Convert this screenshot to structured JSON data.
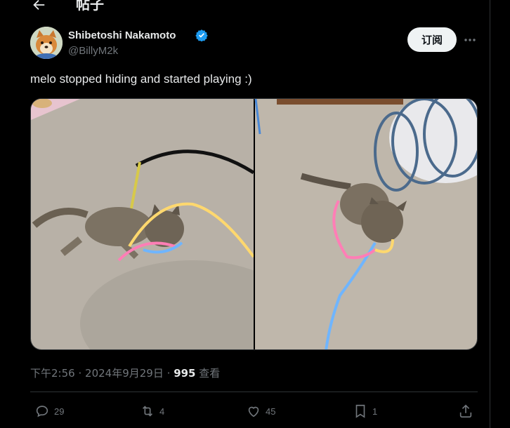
{
  "header": {
    "title": "帖子",
    "back_icon": "back-arrow-icon"
  },
  "author": {
    "display_name": "Shibetoshi Nakamoto",
    "handle": "@BillyM2k",
    "verified_icon": "verified-badge-icon",
    "verified_color": "#1d9bf0"
  },
  "subscribe_label": "订阅",
  "more_icon": "more-horizontal-icon",
  "tweet": {
    "text": "melo stopped hiding and started playing :)"
  },
  "meta": {
    "time": "下午2:56",
    "sep1": "·",
    "date": "2024年9月29日",
    "sep2": "·",
    "views_count": "995",
    "views_label": "查看"
  },
  "actions": {
    "reply": {
      "icon": "reply-icon",
      "count": "29"
    },
    "repost": {
      "icon": "repost-icon",
      "count": "4"
    },
    "like": {
      "icon": "like-icon",
      "count": "45"
    },
    "bookmark": {
      "icon": "bookmark-icon",
      "count": "1"
    },
    "share": {
      "icon": "share-icon"
    }
  },
  "colors": {
    "background": "#000000",
    "text": "#e7e9ea",
    "secondary": "#71767b",
    "border": "#2f3336"
  }
}
